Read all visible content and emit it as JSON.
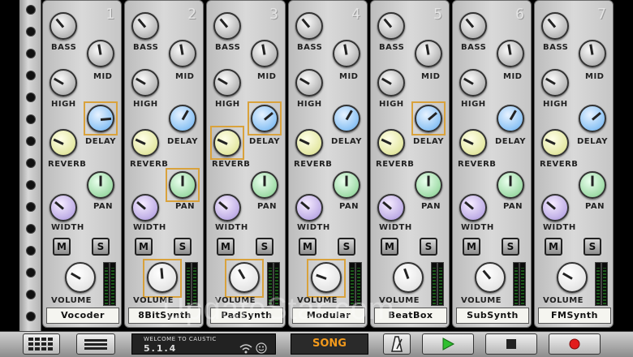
{
  "labels": {
    "bass": "BASS",
    "mid": "MID",
    "high": "HIGH",
    "delay": "DELAY",
    "reverb": "REVERB",
    "pan": "PAN",
    "width": "WIDTH",
    "volume": "VOLUME",
    "mute": "M",
    "solo": "S"
  },
  "channels": [
    {
      "number": "1",
      "name": "Vocoder"
    },
    {
      "number": "2",
      "name": "8BitSynth"
    },
    {
      "number": "3",
      "name": "PadSynth"
    },
    {
      "number": "4",
      "name": "Modular"
    },
    {
      "number": "5",
      "name": "BeatBox"
    },
    {
      "number": "6",
      "name": "SubSynth"
    },
    {
      "number": "7",
      "name": "FMSynth"
    }
  ],
  "status": {
    "welcome": "WELCOME TO CAUSTIC",
    "version": "5.1.4"
  },
  "toolbar": {
    "song_label": "SONG"
  },
  "watermark": "UpdateStar.com",
  "colors": {
    "accent_orange": "#f39a1c",
    "play_green": "#2fbf2f",
    "record_red": "#e21c1c",
    "selection": "#d9a23c"
  },
  "icons": [
    "grid-icon",
    "menu-icon",
    "wifi-icon",
    "smiley-icon",
    "metronome-icon",
    "play-icon",
    "stop-icon",
    "record-icon"
  ]
}
